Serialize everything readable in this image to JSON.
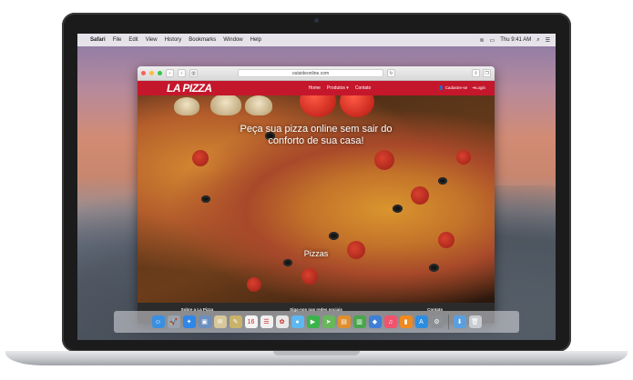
{
  "menubar": {
    "apple": "",
    "items": [
      "Safari",
      "File",
      "Edit",
      "View",
      "History",
      "Bookmarks",
      "Window",
      "Help"
    ],
    "clock": "Thu 9:41 AM"
  },
  "browser": {
    "url": "outsideonline.com"
  },
  "site": {
    "logo": "LA PIZZA",
    "nav": {
      "home": "Home",
      "produtos": "Produtos ▾",
      "contato": "Contato",
      "cadastre": "Cadastre-se",
      "login": "Login"
    },
    "hero": {
      "heading": "Pizzas",
      "subtitle_line1": "Peça sua pizza online sem sair do",
      "subtitle_line2": "conforto de sua casa!"
    },
    "footer": {
      "col1": "Sobre a La Pizza",
      "col2": "Siga-nos nas redes sociais",
      "col3": "Contato"
    }
  },
  "dock": {
    "icons": [
      {
        "name": "finder-icon",
        "glyph": "☺",
        "color": "#3b8fe0"
      },
      {
        "name": "launchpad-icon",
        "glyph": "🚀",
        "color": "#9aa3ad"
      },
      {
        "name": "safari-icon",
        "glyph": "✦",
        "color": "#2f86e6"
      },
      {
        "name": "preview-icon",
        "glyph": "▣",
        "color": "#6b8fbf"
      },
      {
        "name": "mail-icon",
        "glyph": "✉",
        "color": "#d8c79a"
      },
      {
        "name": "notes-icon",
        "glyph": "✎",
        "color": "#c9b36a"
      },
      {
        "name": "calendar-icon",
        "glyph": "16",
        "color": "#f4f4f4"
      },
      {
        "name": "reminders-icon",
        "glyph": "☰",
        "color": "#f0f0f0"
      },
      {
        "name": "photos-icon",
        "glyph": "✿",
        "color": "#e8e8e8"
      },
      {
        "name": "messages-icon",
        "glyph": "●",
        "color": "#5db8f2"
      },
      {
        "name": "facetime-icon",
        "glyph": "▶",
        "color": "#3cb34a"
      },
      {
        "name": "maps-icon",
        "glyph": "➤",
        "color": "#67b85a"
      },
      {
        "name": "ibooks-icon",
        "glyph": "▤",
        "color": "#e08f2e"
      },
      {
        "name": "numbers-icon",
        "glyph": "▥",
        "color": "#4aa64c"
      },
      {
        "name": "keynote-icon",
        "glyph": "◆",
        "color": "#3f7fd6"
      },
      {
        "name": "itunes-icon",
        "glyph": "♫",
        "color": "#f0536e"
      },
      {
        "name": "books-icon",
        "glyph": "▮",
        "color": "#f08a1e"
      },
      {
        "name": "app-store-icon",
        "glyph": "A",
        "color": "#2c8de0"
      },
      {
        "name": "system-preferences-icon",
        "glyph": "⚙",
        "color": "#8c8f94"
      }
    ],
    "after_separator": [
      {
        "name": "downloads-folder-icon",
        "glyph": "⬇",
        "color": "#5aa0e0"
      },
      {
        "name": "trash-icon",
        "glyph": "🗑",
        "color": "#c8ccd2"
      }
    ]
  },
  "colors": {
    "brand_red": "#c5172c",
    "footer_bg": "#2b2b2b"
  }
}
